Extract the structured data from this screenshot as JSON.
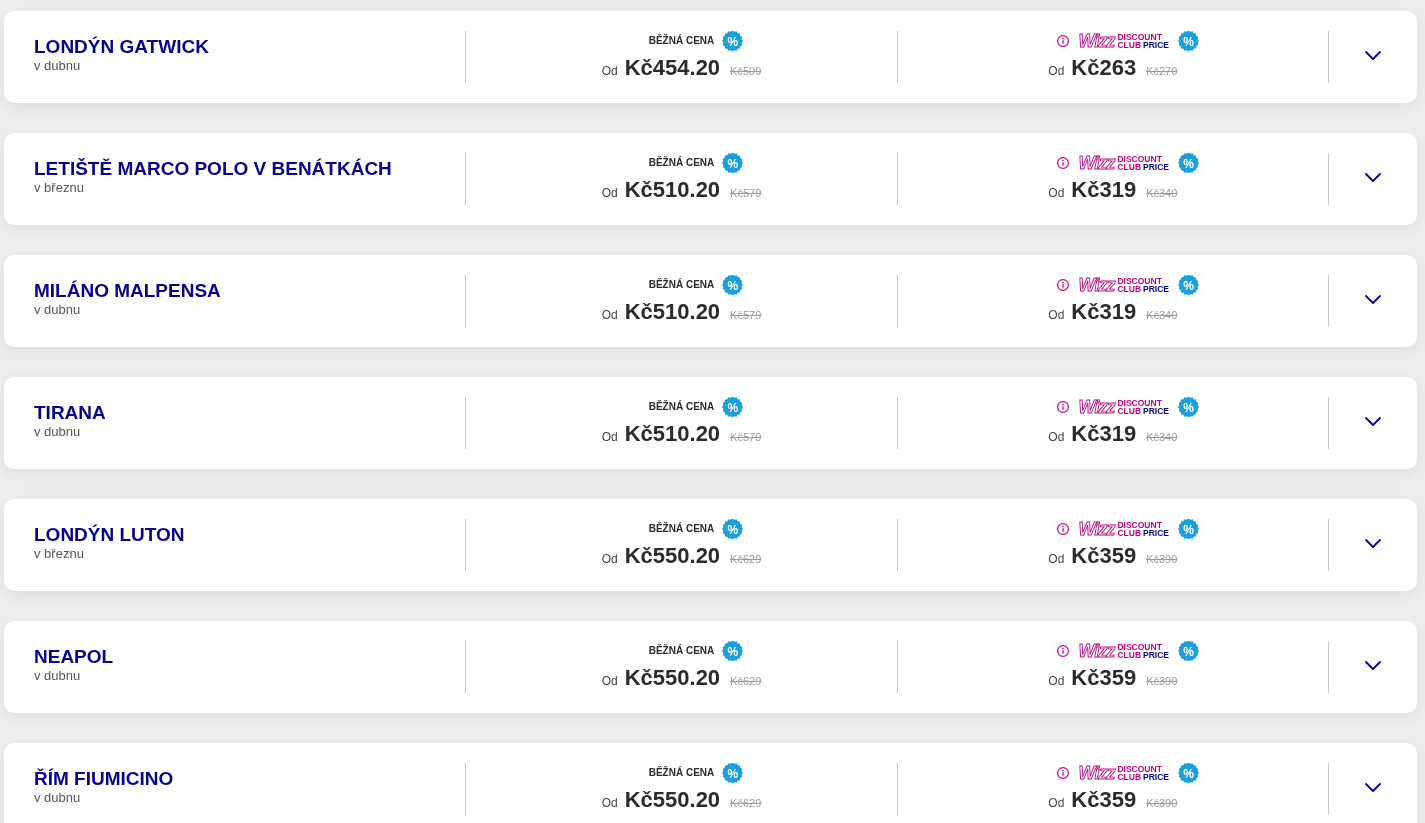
{
  "routes": [
    {
      "destination": "LONDÝN GATWICK",
      "period": "v dubnu",
      "expanded": false,
      "regular": {
        "label": "BĚŽNÁ CENA",
        "badge": "%",
        "from": "Od",
        "price": "Kč454.20",
        "old_price": "Kč509"
      },
      "club": {
        "logo": "Wizz",
        "line_1": "DISCOUNT",
        "line_2_club": "CLUB",
        "line_2_price": "PRICE",
        "badge": "%",
        "from": "Od",
        "price": "Kč263",
        "old_price": "Kč270"
      }
    },
    {
      "destination": "LETIŠTĚ MARCO POLO V BENÁTKÁCH",
      "period": "v březnu",
      "expanded": false,
      "regular": {
        "label": "BĚŽNÁ CENA",
        "badge": "%",
        "from": "Od",
        "price": "Kč510.20",
        "old_price": "Kč579"
      },
      "club": {
        "logo": "Wizz",
        "line_1": "DISCOUNT",
        "line_2_club": "CLUB",
        "line_2_price": "PRICE",
        "badge": "%",
        "from": "Od",
        "price": "Kč319",
        "old_price": "Kč340"
      }
    },
    {
      "destination": "MILÁNO MALPENSA",
      "period": "v dubnu",
      "expanded": false,
      "regular": {
        "label": "BĚŽNÁ CENA",
        "badge": "%",
        "from": "Od",
        "price": "Kč510.20",
        "old_price": "Kč579"
      },
      "club": {
        "logo": "Wizz",
        "line_1": "DISCOUNT",
        "line_2_club": "CLUB",
        "line_2_price": "PRICE",
        "badge": "%",
        "from": "Od",
        "price": "Kč319",
        "old_price": "Kč340"
      }
    },
    {
      "destination": "TIRANA",
      "period": "v dubnu",
      "expanded": false,
      "regular": {
        "label": "BĚŽNÁ CENA",
        "badge": "%",
        "from": "Od",
        "price": "Kč510.20",
        "old_price": "Kč579"
      },
      "club": {
        "logo": "Wizz",
        "line_1": "DISCOUNT",
        "line_2_club": "CLUB",
        "line_2_price": "PRICE",
        "badge": "%",
        "from": "Od",
        "price": "Kč319",
        "old_price": "Kč340"
      }
    },
    {
      "destination": "LONDÝN LUTON",
      "period": "v březnu",
      "expanded": false,
      "regular": {
        "label": "BĚŽNÁ CENA",
        "badge": "%",
        "from": "Od",
        "price": "Kč550.20",
        "old_price": "Kč629"
      },
      "club": {
        "logo": "Wizz",
        "line_1": "DISCOUNT",
        "line_2_club": "CLUB",
        "line_2_price": "PRICE",
        "badge": "%",
        "from": "Od",
        "price": "Kč359",
        "old_price": "Kč390"
      }
    },
    {
      "destination": "NEAPOL",
      "period": "v dubnu",
      "expanded": false,
      "regular": {
        "label": "BĚŽNÁ CENA",
        "badge": "%",
        "from": "Od",
        "price": "Kč550.20",
        "old_price": "Kč629"
      },
      "club": {
        "logo": "Wizz",
        "line_1": "DISCOUNT",
        "line_2_club": "CLUB",
        "line_2_price": "PRICE",
        "badge": "%",
        "from": "Od",
        "price": "Kč359",
        "old_price": "Kč390"
      }
    },
    {
      "destination": "ŘÍM FIUMICINO",
      "period": "v dubnu",
      "expanded": false,
      "regular": {
        "label": "BĚŽNÁ CENA",
        "badge": "%",
        "from": "Od",
        "price": "Kč550.20",
        "old_price": "Kč629"
      },
      "club": {
        "logo": "Wizz",
        "line_1": "DISCOUNT",
        "line_2_club": "CLUB",
        "line_2_price": "PRICE",
        "badge": "%",
        "from": "Od",
        "price": "Kč359",
        "old_price": "Kč390"
      }
    }
  ]
}
